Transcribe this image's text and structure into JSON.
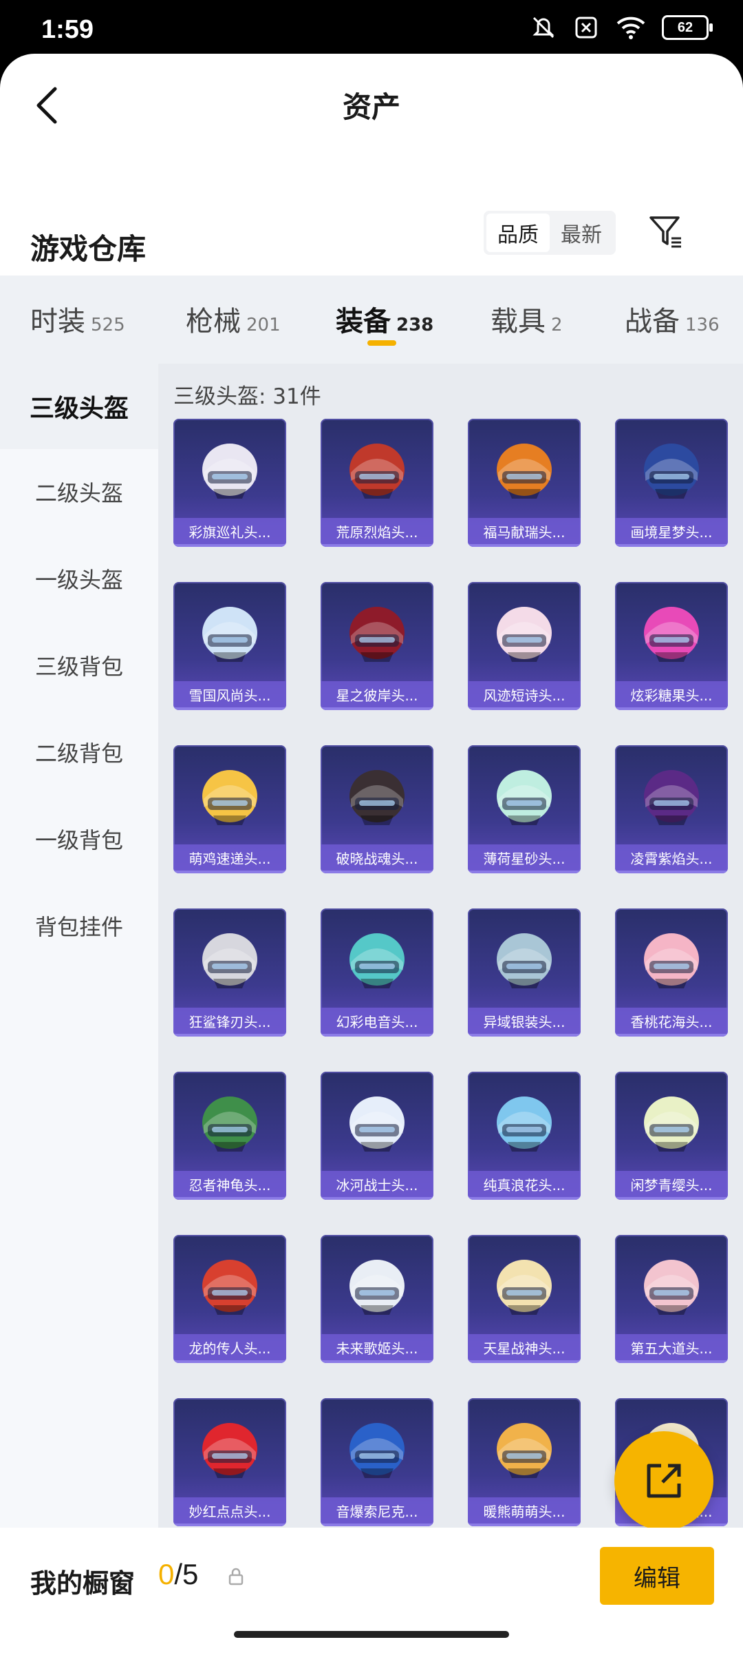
{
  "status_bar": {
    "time": "1:59",
    "battery": "62"
  },
  "header": {
    "title": "资产"
  },
  "section": {
    "title": "游戏仓库"
  },
  "sort": {
    "options": [
      "品质",
      "最新"
    ],
    "active": "品质"
  },
  "tabs": [
    {
      "label": "时装",
      "count": "525"
    },
    {
      "label": "枪械",
      "count": "201"
    },
    {
      "label": "装备",
      "count": "238"
    },
    {
      "label": "载具",
      "count": "2"
    },
    {
      "label": "战备",
      "count": "136"
    }
  ],
  "active_tab": "装备",
  "sidebar": [
    {
      "label": "三级头盔"
    },
    {
      "label": "二级头盔"
    },
    {
      "label": "一级头盔"
    },
    {
      "label": "三级背包"
    },
    {
      "label": "二级背包"
    },
    {
      "label": "一级背包"
    },
    {
      "label": "背包挂件"
    }
  ],
  "content": {
    "count_label": "三级头盔: 31件"
  },
  "items": [
    {
      "name": "彩旗巡礼头...",
      "color": "#e9e6f2"
    },
    {
      "name": "荒原烈焰头...",
      "color": "#c0392b"
    },
    {
      "name": "福马献瑞头...",
      "color": "#e67e22"
    },
    {
      "name": "画境星梦头...",
      "color": "#2c4aa0"
    },
    {
      "name": "雪国风尚头...",
      "color": "#cfe3f7"
    },
    {
      "name": "星之彼岸头...",
      "color": "#8e1b2a"
    },
    {
      "name": "风迹短诗头...",
      "color": "#f4dbe8"
    },
    {
      "name": "炫彩糖果头...",
      "color": "#e84ab8"
    },
    {
      "name": "萌鸡速递头...",
      "color": "#f6c445"
    },
    {
      "name": "破晓战魂头...",
      "color": "#3a2f33"
    },
    {
      "name": "薄荷星砂头...",
      "color": "#bfeee0"
    },
    {
      "name": "凌霄紫焰头...",
      "color": "#5b2a86"
    },
    {
      "name": "狂鲨锋刃头...",
      "color": "#d7d7de"
    },
    {
      "name": "幻彩电音头...",
      "color": "#55c8c8"
    },
    {
      "name": "异域银装头...",
      "color": "#a9c6d6"
    },
    {
      "name": "香桃花海头...",
      "color": "#f5b5c6"
    },
    {
      "name": "忍者神龟头...",
      "color": "#3f8f4a"
    },
    {
      "name": "冰河战士头...",
      "color": "#e6eefa"
    },
    {
      "name": "纯真浪花头...",
      "color": "#7fc7ee"
    },
    {
      "name": "闲梦青缨头...",
      "color": "#e9f1c6"
    },
    {
      "name": "龙的传人头...",
      "color": "#d8402f"
    },
    {
      "name": "未来歌姬头...",
      "color": "#e9eef5"
    },
    {
      "name": "天星战神头...",
      "color": "#f3e2b0"
    },
    {
      "name": "第五大道头...",
      "color": "#f3c4cf"
    },
    {
      "name": "妙红点点头...",
      "color": "#e0262e"
    },
    {
      "name": "音爆索尼克...",
      "color": "#2a61c9"
    },
    {
      "name": "暖熊萌萌头...",
      "color": "#f1b24a"
    },
    {
      "name": "田园牧歌头...",
      "color": "#f0e6c8"
    }
  ],
  "showcase": {
    "label": "我的橱窗",
    "current": "0",
    "total": "/5",
    "edit_label": "编辑"
  }
}
